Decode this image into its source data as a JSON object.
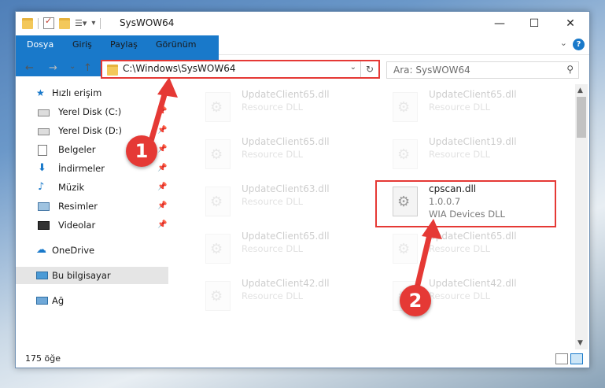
{
  "window": {
    "title": "SysWOW64",
    "controls": {
      "minimize": "—",
      "maximize": "☐",
      "close": "✕"
    }
  },
  "ribbon": {
    "tabs": [
      "Dosya",
      "Giriş",
      "Paylaş",
      "Görünüm"
    ],
    "help": "?"
  },
  "nav": {
    "back": "←",
    "forward": "→",
    "recent": "⌄",
    "up": "↑",
    "address": "C:\\Windows\\SysWOW64",
    "search_placeholder": "Ara: SysWOW64"
  },
  "sidebar": {
    "quick_access": "Hızlı erişim",
    "items": [
      {
        "label": "Yerel Disk (C:)",
        "icon": "drive-icon"
      },
      {
        "label": "Yerel Disk (D:)",
        "icon": "drive-icon"
      },
      {
        "label": "Belgeler",
        "icon": "documents-icon"
      },
      {
        "label": "İndirmeler",
        "icon": "download-icon"
      },
      {
        "label": "Müzik",
        "icon": "music-icon"
      },
      {
        "label": "Resimler",
        "icon": "pictures-icon"
      },
      {
        "label": "Videolar",
        "icon": "videos-icon"
      }
    ],
    "onedrive": "OneDrive",
    "this_pc": "Bu bilgisayar",
    "network": "Ağ"
  },
  "files": [
    {
      "name": "UpdateClient65.dll",
      "desc": "Resource DLL",
      "faded": true
    },
    {
      "name": "UpdateClient65.dll",
      "desc": "Resource DLL",
      "faded": true
    },
    {
      "name": "UpdateClient65.dll",
      "desc": "Resource DLL",
      "faded": true
    },
    {
      "name": "UpdateClient19.dll",
      "desc": "Resource DLL",
      "faded": true
    },
    {
      "name": "UpdateClient63.dll",
      "desc": "Resource DLL",
      "faded": true
    },
    {
      "name": "cpscan.dll",
      "version": "1.0.0.7",
      "desc": "WIA Devices DLL",
      "faded": false
    },
    {
      "name": "UpdateClient65.dll",
      "desc": "Resource DLL",
      "faded": true
    },
    {
      "name": "UpdateClient65.dll",
      "desc": "Resource DLL",
      "faded": true
    },
    {
      "name": "UpdateClient42.dll",
      "desc": "Resource DLL",
      "faded": true
    },
    {
      "name": "UpdateClient42.dll",
      "desc": "Resource DLL",
      "faded": true
    }
  ],
  "status": {
    "count": "175 öğe"
  },
  "annotations": {
    "step1": "1",
    "step2": "2",
    "color": "#e53935"
  },
  "colors": {
    "accent": "#1979ca",
    "highlight": "#e53935"
  }
}
